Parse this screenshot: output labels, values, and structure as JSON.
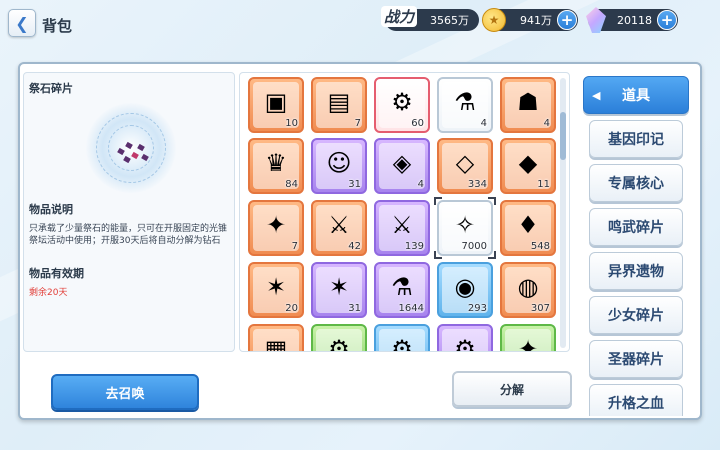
{
  "header": {
    "back_icon": "chevron-left-icon",
    "title": "背包"
  },
  "resources": {
    "power_label": "战力",
    "power_value": "3565万",
    "coins_value": "941万",
    "gems_value": "20118",
    "plus_label": "+"
  },
  "detail": {
    "item_name": "祭石碎片",
    "desc_title": "物品说明",
    "desc_text": "只承载了少量祭石的能量，只可在开服固定的光锥祭坛活动中使用；开服30天后将自动分解为钻石",
    "validity_title": "物品有效期",
    "validity_value": "剩余20天"
  },
  "items": [
    {
      "frame": "orange",
      "icon": "treasure-chest-icon",
      "glyph": "▣",
      "count": "10"
    },
    {
      "frame": "orange",
      "icon": "supply-box-icon",
      "glyph": "▤",
      "count": "7"
    },
    {
      "frame": "red",
      "icon": "gear-device-icon",
      "glyph": "⚙",
      "count": "60"
    },
    {
      "frame": "white",
      "icon": "potion-bottle-icon",
      "glyph": "⚗",
      "count": "4"
    },
    {
      "frame": "orange",
      "icon": "cauldron-icon",
      "glyph": "☗",
      "count": "4"
    },
    {
      "frame": "orange",
      "icon": "ticket-pink-icon",
      "glyph": "♛",
      "count": "84"
    },
    {
      "frame": "purple",
      "icon": "ticket-purple-icon",
      "glyph": "☺",
      "count": "31"
    },
    {
      "frame": "purple",
      "icon": "card-gold-icon",
      "glyph": "◈",
      "count": "4"
    },
    {
      "frame": "orange",
      "icon": "card-gold-stack-icon",
      "glyph": "◇",
      "count": "334"
    },
    {
      "frame": "orange",
      "icon": "card-pink-icon",
      "glyph": "◆",
      "count": "11"
    },
    {
      "frame": "orange",
      "icon": "ticket-rainbow-icon",
      "glyph": "✦",
      "count": "7"
    },
    {
      "frame": "orange",
      "icon": "card-sword-icon",
      "glyph": "⚔",
      "count": "42"
    },
    {
      "frame": "purple",
      "icon": "card-sword-blue-icon",
      "glyph": "⚔",
      "count": "139"
    },
    {
      "frame": "white",
      "icon": "altar-stone-shard-icon",
      "glyph": "✧",
      "count": "7000",
      "selected": true
    },
    {
      "frame": "orange",
      "icon": "crystal-icon",
      "glyph": "♦",
      "count": "548"
    },
    {
      "frame": "orange",
      "icon": "card-star-icon",
      "glyph": "✶",
      "count": "20"
    },
    {
      "frame": "purple",
      "icon": "card-star-purple-icon",
      "glyph": "✶",
      "count": "31"
    },
    {
      "frame": "purple",
      "icon": "test-tube-icon",
      "glyph": "⚗",
      "count": "1644"
    },
    {
      "frame": "blue",
      "icon": "candy-icon",
      "glyph": "◉",
      "count": "293"
    },
    {
      "frame": "orange",
      "icon": "cookie-icon",
      "glyph": "◍",
      "count": "307"
    },
    {
      "frame": "orange",
      "icon": "scroll-icon",
      "glyph": "▦",
      "count": ""
    },
    {
      "frame": "green",
      "icon": "robot-part-icon",
      "glyph": "⚙",
      "count": ""
    },
    {
      "frame": "blue",
      "icon": "device-icon",
      "glyph": "⚙",
      "count": ""
    },
    {
      "frame": "purple",
      "icon": "machine-part-icon",
      "glyph": "⚙",
      "count": ""
    },
    {
      "frame": "green",
      "icon": "crystal-cluster-icon",
      "glyph": "✦",
      "count": ""
    }
  ],
  "categories": [
    {
      "label": "道具",
      "active": true
    },
    {
      "label": "基因印记"
    },
    {
      "label": "专属核心"
    },
    {
      "label": "鸣武碎片"
    },
    {
      "label": "异界遗物"
    },
    {
      "label": "少女碎片"
    },
    {
      "label": "圣器碎片"
    },
    {
      "label": "升格之血"
    }
  ],
  "buttons": {
    "summon": "去召唤",
    "decompose": "分解"
  }
}
